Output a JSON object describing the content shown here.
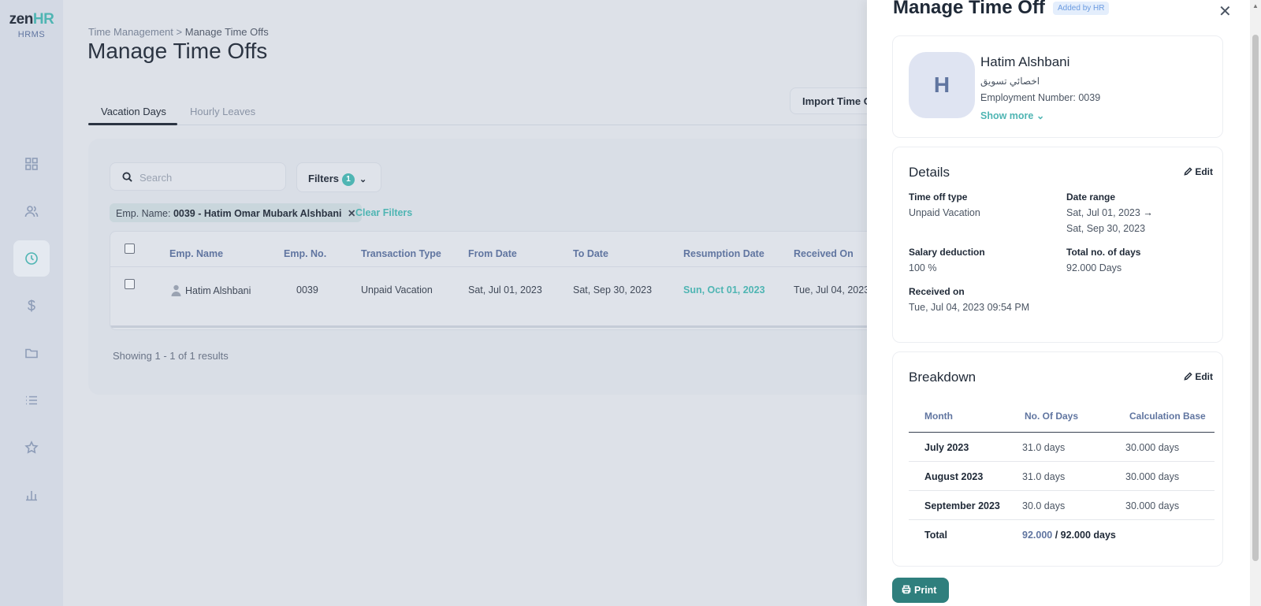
{
  "brand": {
    "logo_zen": "zen",
    "logo_hr": "HR",
    "logo_sub": "HRMS"
  },
  "sidebar": {
    "items": [
      {
        "icon": "dashboard-icon"
      },
      {
        "icon": "users-icon"
      },
      {
        "icon": "clock-icon",
        "active": true
      },
      {
        "icon": "dollar-icon"
      },
      {
        "icon": "folder-icon"
      },
      {
        "icon": "list-icon"
      },
      {
        "icon": "star-icon"
      },
      {
        "icon": "bar-chart-icon"
      }
    ]
  },
  "breadcrumb": {
    "parent": "Time Management",
    "separator": ">",
    "current": "Manage Time Offs"
  },
  "page": {
    "title": "Manage Time Offs"
  },
  "tabs": [
    {
      "label": "Vacation Days",
      "active": true
    },
    {
      "label": "Hourly Leaves"
    }
  ],
  "toolbar": {
    "import_label": "Import Time Of"
  },
  "search": {
    "placeholder": "Search",
    "value": ""
  },
  "filters": {
    "label": "Filters",
    "count": "1"
  },
  "active_filter": {
    "label": "Emp. Name:",
    "value": "0039 - Hatim Omar Mubark Alshbani"
  },
  "clear_filters_label": "Clear Filters",
  "table": {
    "columns": [
      "Emp. Name",
      "Emp. No.",
      "Transaction Type",
      "From Date",
      "To Date",
      "Resumption Date",
      "Received On"
    ],
    "rows": [
      {
        "emp_name": "Hatim Alshbani",
        "emp_no": "0039",
        "transaction_type": "Unpaid Vacation",
        "from_date": "Sat, Jul 01, 2023",
        "to_date": "Sat, Sep 30, 2023",
        "resumption_date": "Sun, Oct 01, 2023",
        "received_on": "Tue, Jul 04, 2023"
      }
    ]
  },
  "pagination": {
    "summary": "Showing 1 - 1 of 1 results"
  },
  "panel": {
    "title": "Manage Time Off",
    "badge": "Added by HR",
    "close_icon": "close-icon",
    "employee": {
      "initial": "H",
      "name": "Hatim Alshbani",
      "job_title": "اخصائي تسويق",
      "employment_number": "Employment Number: 0039",
      "show_more": "Show more"
    },
    "details": {
      "title": "Details",
      "edit_label": "Edit",
      "time_off_type_label": "Time off type",
      "time_off_type": "Unpaid Vacation",
      "date_range_label": "Date range",
      "date_from": "Sat, Jul 01, 2023",
      "date_to": "Sat, Sep 30, 2023",
      "salary_deduction_label": "Salary deduction",
      "salary_deduction": "100 %",
      "total_days_label": "Total no. of days",
      "total_days": "92.000 Days",
      "received_on_label": "Received on",
      "received_on": "Tue, Jul 04, 2023 09:54 PM"
    },
    "breakdown": {
      "title": "Breakdown",
      "edit_label": "Edit",
      "columns": [
        "Month",
        "No. Of Days",
        "Calculation Base"
      ],
      "rows": [
        {
          "month": "July 2023",
          "days": "31.0 days",
          "base": "30.000 days"
        },
        {
          "month": "August 2023",
          "days": "31.0 days",
          "base": "30.000 days"
        },
        {
          "month": "September 2023",
          "days": "30.0 days",
          "base": "30.000 days"
        }
      ],
      "total_label": "Total",
      "total_value": "92.000",
      "total_of": "/ 92.000 days"
    },
    "print_label": "Print"
  },
  "colors": {
    "accent": "#4fb5b3",
    "print_button": "#2f7f7d",
    "muted_blue": "#6075a0"
  }
}
